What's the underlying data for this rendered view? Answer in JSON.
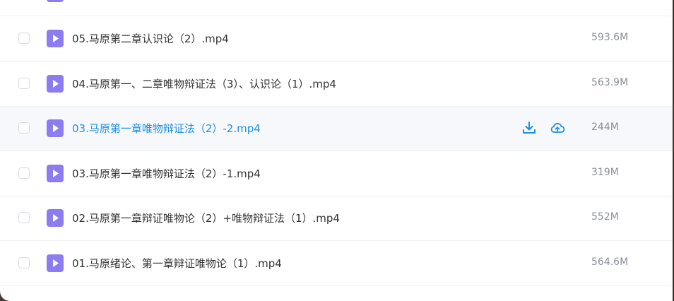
{
  "files": [
    {
      "name": "05.马原第二章认识论（2）.mp4",
      "size": "593.6M"
    },
    {
      "name": "04.马原第一、二章唯物辩证法（3）、认识论（1）.mp4",
      "size": "563.9M"
    },
    {
      "name": "03.马原第一章唯物辩证法（2）-2.mp4",
      "size": "244M"
    },
    {
      "name": "03.马原第一章唯物辩证法（2）-1.mp4",
      "size": "319M"
    },
    {
      "name": "02.马原第一章辩证唯物论（2）+唯物辩证法（1）.mp4",
      "size": "552M"
    },
    {
      "name": "01.马原绪论、第一章辩证唯物论（1）.mp4",
      "size": "564.6M"
    }
  ],
  "hovered_row": 2,
  "colors": {
    "icon_purple": "#8c7cf0",
    "link_blue": "#1f8fe5"
  },
  "icons": {
    "file": "video-file-icon",
    "download": "download-icon",
    "save_cloud": "cloud-save-icon"
  }
}
